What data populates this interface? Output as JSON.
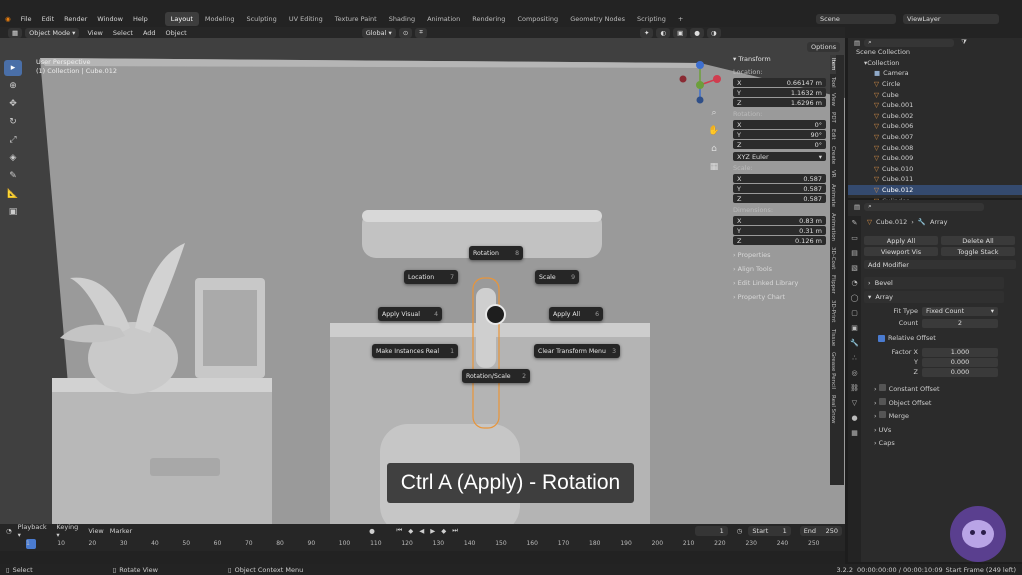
{
  "menu": [
    "File",
    "Edit",
    "Render",
    "Window",
    "Help"
  ],
  "workspaces": [
    "Layout",
    "Modeling",
    "Sculpting",
    "UV Editing",
    "Texture Paint",
    "Shading",
    "Animation",
    "Rendering",
    "Compositing",
    "Geometry Nodes",
    "Scripting"
  ],
  "scene": "Scene",
  "view_layer": "ViewLayer",
  "header": {
    "mode": "Object Mode",
    "view": "View",
    "select": "Select",
    "add": "Add",
    "object": "Object",
    "orientation": "Global",
    "options": "Options"
  },
  "viewport": {
    "persp": "User Perspective",
    "collection": "(1) Collection | Cube.012"
  },
  "pie": {
    "rotation": {
      "label": "Rotation",
      "num": "8"
    },
    "location": {
      "label": "Location",
      "num": "7"
    },
    "scale": {
      "label": "Scale",
      "num": "9"
    },
    "apply_visual": {
      "label": "Apply Visual",
      "num": "4"
    },
    "apply_all": {
      "label": "Apply All",
      "num": "6"
    },
    "make_instances": {
      "label": "Make Instances Real",
      "num": "1"
    },
    "clear_transform": {
      "label": "Clear Transform Menu",
      "num": "3"
    },
    "rotation_scale": {
      "label": "Rotation/Scale",
      "num": "2"
    }
  },
  "caption": "Ctrl A (Apply) - Rotation",
  "npanel": {
    "title": "Transform",
    "location": "Location:",
    "loc": [
      {
        "a": "X",
        "v": "0.66147 m"
      },
      {
        "a": "Y",
        "v": "1.1632 m"
      },
      {
        "a": "Z",
        "v": "1.6296 m"
      }
    ],
    "rotation": "Rotation:",
    "rot": [
      {
        "a": "X",
        "v": "0°"
      },
      {
        "a": "Y",
        "v": "90°"
      },
      {
        "a": "Z",
        "v": "0°"
      }
    ],
    "euler": "XYZ Euler",
    "scale": "Scale:",
    "scl": [
      {
        "a": "X",
        "v": "0.587"
      },
      {
        "a": "Y",
        "v": "0.587"
      },
      {
        "a": "Z",
        "v": "0.587"
      }
    ],
    "dimensions": "Dimensions:",
    "dim": [
      {
        "a": "X",
        "v": "0.83 m"
      },
      {
        "a": "Y",
        "v": "0.31 m"
      },
      {
        "a": "Z",
        "v": "0.126 m"
      }
    ],
    "sections": [
      "Properties",
      "Align Tools",
      "Edit Linked Library",
      "Property Chart"
    ]
  },
  "ntabs": [
    "Item",
    "Tool",
    "View",
    "PDT",
    "Edit",
    "Create",
    "VR",
    "Animate",
    "Animation",
    "3D-Coat",
    "Flipper",
    "3D-Print",
    "Tissue",
    "Grease Pencil",
    "Real Snow"
  ],
  "outliner": {
    "root": "Scene Collection",
    "collection": "Collection",
    "items": [
      "Camera",
      "Circle",
      "Cube",
      "Cube.001",
      "Cube.002",
      "Cube.006",
      "Cube.007",
      "Cube.008",
      "Cube.009",
      "Cube.010",
      "Cube.011",
      "Cube.012",
      "Cylinder"
    ],
    "selected": "Cube.012"
  },
  "props": {
    "object": "Cube.012",
    "modifier": "Array",
    "apply_all": "Apply All",
    "delete_all": "Delete All",
    "viewport_vis": "Viewport Vis",
    "toggle_stack": "Toggle Stack",
    "add_modifier": "Add Modifier",
    "mod1": "Bevel",
    "mod2": "Array",
    "fit_type_label": "Fit Type",
    "fit_type": "Fixed Count",
    "count_label": "Count",
    "count": "2",
    "relative_offset": "Relative Offset",
    "factor": [
      {
        "a": "Factor X",
        "v": "1.000"
      },
      {
        "a": "Y",
        "v": "0.000"
      },
      {
        "a": "Z",
        "v": "0.000"
      }
    ],
    "subs": [
      "Constant Offset",
      "Object Offset",
      "Merge",
      "UVs",
      "Caps"
    ]
  },
  "timeline": {
    "playback": "Playback",
    "keying": "Keying",
    "view": "View",
    "marker": "Marker",
    "frame": "1",
    "start_label": "Start",
    "start": "1",
    "end_label": "End",
    "end": "250",
    "ticks": [
      "1",
      "10",
      "20",
      "30",
      "40",
      "50",
      "60",
      "70",
      "80",
      "90",
      "100",
      "110",
      "120",
      "130",
      "140",
      "150",
      "160",
      "170",
      "180",
      "190",
      "200",
      "210",
      "220",
      "230",
      "240",
      "250"
    ]
  },
  "status": {
    "select": "Select",
    "rotate": "Rotate View",
    "context": "Object Context Menu",
    "version": "3.2.2",
    "time": "00:00:00:00 / 00:00:10:09",
    "sf": "Start Frame (249 left)"
  }
}
